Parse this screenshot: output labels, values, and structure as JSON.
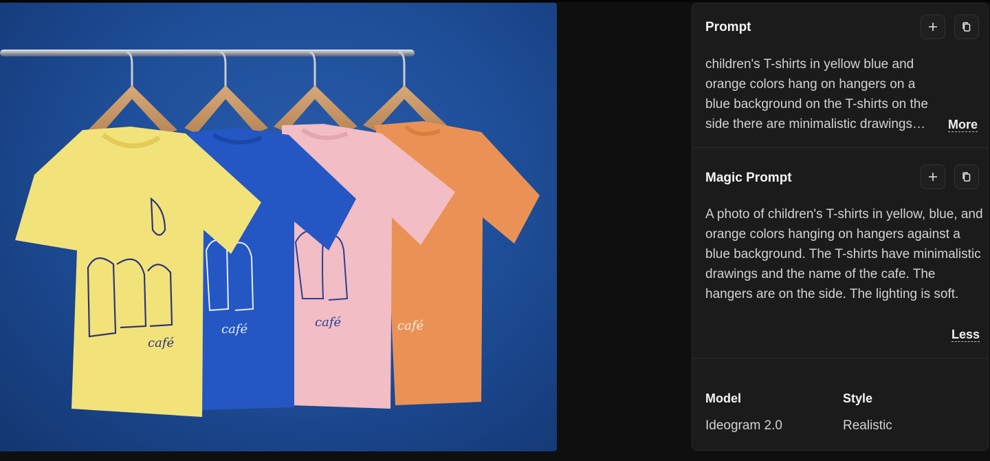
{
  "image": {
    "alt_subject": "four children's t-shirts on hangers",
    "shirt_print": "café",
    "colors": {
      "background": "#1e4c96",
      "shirt_yellow": "#f2e27a",
      "shirt_blue": "#2457c4",
      "shirt_pink": "#f2bdc4",
      "shirt_orange": "#ea9256"
    }
  },
  "prompt": {
    "title": "Prompt",
    "text": "children's T-shirts in yellow blue and orange colors hang on hangers on a blue background on the T-shirts on the side there are minimalistic drawings and the...",
    "more_label": "More",
    "add_icon": "plus-icon",
    "copy_icon": "copy-icon"
  },
  "magic_prompt": {
    "title": "Magic Prompt",
    "text": "A photo of children's T-shirts in yellow, blue, and orange colors hanging on hangers against a blue background. The T-shirts have minimalistic drawings and the name of the cafe. The hangers are on the side. The lighting is soft.",
    "less_label": "Less",
    "add_icon": "plus-icon",
    "copy_icon": "copy-icon"
  },
  "meta": {
    "model_label": "Model",
    "model_value": "Ideogram 2.0",
    "style_label": "Style",
    "style_value": "Realistic"
  }
}
